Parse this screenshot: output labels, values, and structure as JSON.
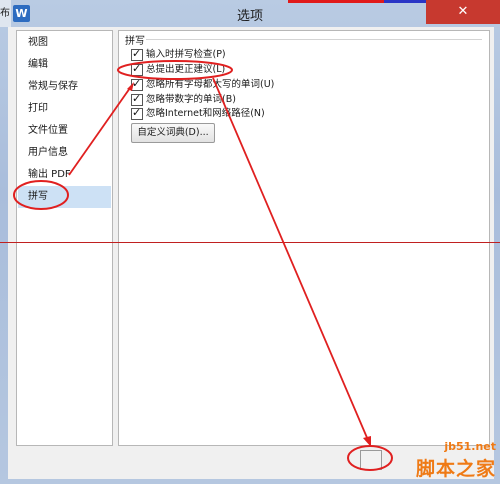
{
  "window": {
    "title": "选项",
    "prev_window_text": "布",
    "app_icon": "W"
  },
  "sidebar": {
    "items": [
      {
        "label": "视图"
      },
      {
        "label": "编辑"
      },
      {
        "label": "常规与保存"
      },
      {
        "label": "打印"
      },
      {
        "label": "文件位置"
      },
      {
        "label": "用户信息"
      },
      {
        "label": "输出 PDF"
      },
      {
        "label": "拼写"
      }
    ],
    "selected": "拼写"
  },
  "spelling": {
    "group_title": "拼写",
    "options": [
      {
        "label": "输入时拼写检查(P)",
        "checked": true
      },
      {
        "label": "总提出更正建议(L)",
        "checked": true
      },
      {
        "label": "忽略所有字母都大写的单词(U)",
        "checked": true
      },
      {
        "label": "忽略带数字的单词(B)",
        "checked": true
      },
      {
        "label": "忽略Internet和网络路径(N)",
        "checked": true
      }
    ],
    "dict_button": "自定义词典(D)..."
  },
  "watermark": {
    "url": "jb51.net",
    "name": "脚本之家"
  },
  "colors": {
    "annotation": "#e02020",
    "selected_bg": "#cde1f5",
    "close": "#c7392f"
  }
}
